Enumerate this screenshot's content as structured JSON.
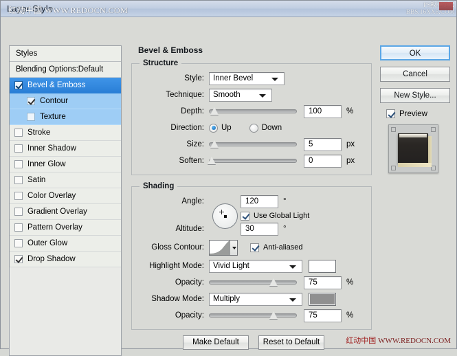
{
  "window": {
    "title": "Layer Style",
    "watermark_title": "红动中国 WWW.REDOCN.COM",
    "watermark_corner_line1": "PS教程论坛",
    "watermark_corner_line2": "BBS.16XX8.COM",
    "watermark_bottom_cn": "红动中国",
    "watermark_bottom_url": "WWW.REDOCN.COM"
  },
  "styles_panel": {
    "header": "Styles",
    "blending_options": "Blending Options:Default",
    "effects": [
      {
        "label": "Bevel & Emboss",
        "checked": true,
        "selected": true,
        "sub": false
      },
      {
        "label": "Contour",
        "checked": true,
        "selected": false,
        "sub": true
      },
      {
        "label": "Texture",
        "checked": false,
        "selected": false,
        "sub": true
      },
      {
        "label": "Stroke",
        "checked": false,
        "selected": false,
        "sub": false
      },
      {
        "label": "Inner Shadow",
        "checked": false,
        "selected": false,
        "sub": false
      },
      {
        "label": "Inner Glow",
        "checked": false,
        "selected": false,
        "sub": false
      },
      {
        "label": "Satin",
        "checked": false,
        "selected": false,
        "sub": false
      },
      {
        "label": "Color Overlay",
        "checked": false,
        "selected": false,
        "sub": false
      },
      {
        "label": "Gradient Overlay",
        "checked": false,
        "selected": false,
        "sub": false
      },
      {
        "label": "Pattern Overlay",
        "checked": false,
        "selected": false,
        "sub": false
      },
      {
        "label": "Outer Glow",
        "checked": false,
        "selected": false,
        "sub": false
      },
      {
        "label": "Drop Shadow",
        "checked": true,
        "selected": false,
        "sub": false
      }
    ]
  },
  "main": {
    "title": "Bevel & Emboss",
    "structure": {
      "legend": "Structure",
      "style_label": "Style:",
      "style_value": "Inner Bevel",
      "technique_label": "Technique:",
      "technique_value": "Smooth",
      "depth_label": "Depth:",
      "depth_value": "100",
      "depth_unit": "%",
      "direction_label": "Direction:",
      "direction_up": "Up",
      "direction_down": "Down",
      "direction_selected": "Up",
      "size_label": "Size:",
      "size_value": "5",
      "size_unit": "px",
      "soften_label": "Soften:",
      "soften_value": "0",
      "soften_unit": "px"
    },
    "shading": {
      "legend": "Shading",
      "angle_label": "Angle:",
      "angle_value": "120",
      "angle_unit": "°",
      "use_global_light": "Use Global Light",
      "use_global_light_checked": true,
      "altitude_label": "Altitude:",
      "altitude_value": "30",
      "altitude_unit": "°",
      "gloss_contour_label": "Gloss Contour:",
      "anti_aliased": "Anti-aliased",
      "anti_aliased_checked": true,
      "highlight_mode_label": "Highlight Mode:",
      "highlight_mode_value": "Vivid Light",
      "highlight_color": "#ffffff",
      "highlight_opacity_label": "Opacity:",
      "highlight_opacity_value": "75",
      "highlight_opacity_unit": "%",
      "shadow_mode_label": "Shadow Mode:",
      "shadow_mode_value": "Multiply",
      "shadow_color": "#909090",
      "shadow_opacity_label": "Opacity:",
      "shadow_opacity_value": "75",
      "shadow_opacity_unit": "%"
    }
  },
  "buttons": {
    "ok": "OK",
    "cancel": "Cancel",
    "new_style": "New Style...",
    "preview": "Preview",
    "preview_checked": true,
    "make_default": "Make Default",
    "reset_to_default": "Reset to Default"
  }
}
